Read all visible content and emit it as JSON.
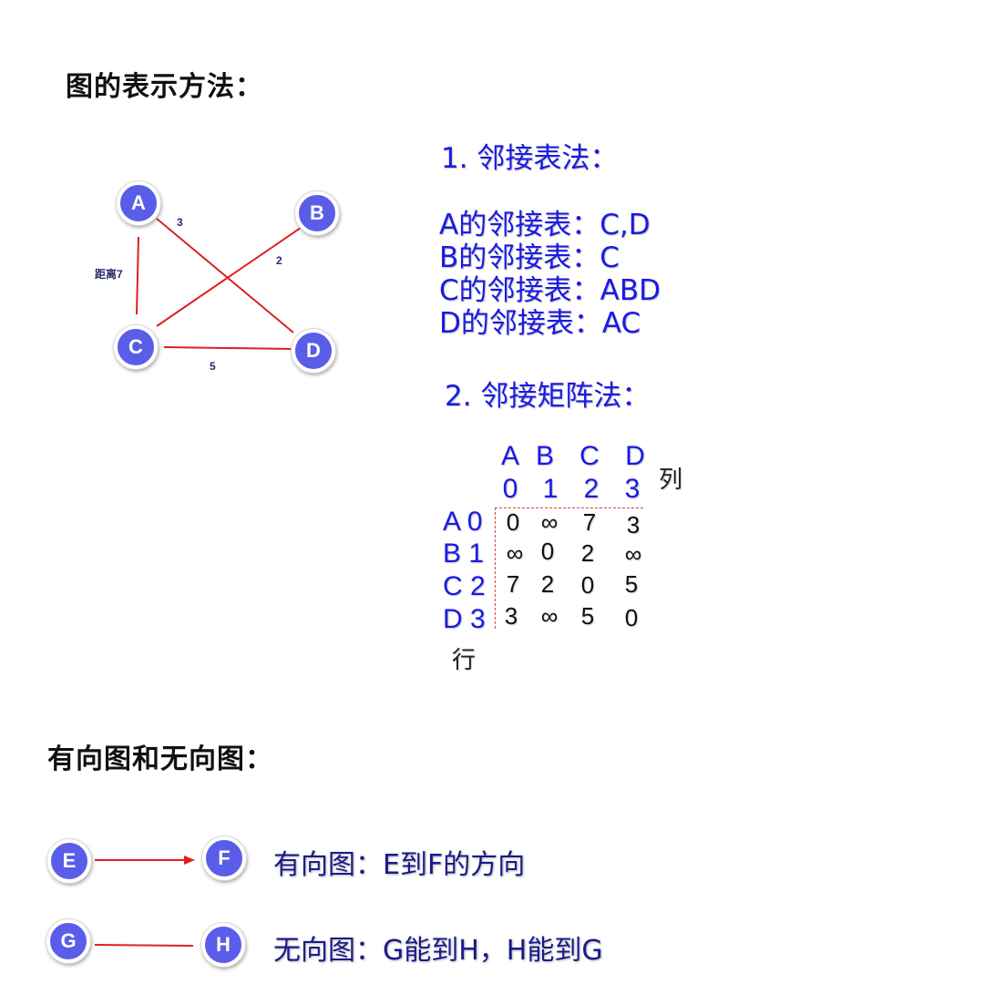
{
  "section1_title": "图的表示方法：",
  "section2_title": "有向图和无向图：",
  "graph": {
    "nodes": [
      "A",
      "B",
      "C",
      "D"
    ],
    "edge_labels": {
      "AD": "3",
      "BC": "2",
      "AC": "距离7",
      "CD": "5"
    },
    "edge_color": "#e02020",
    "node_color": "#5a5de8"
  },
  "adjacency_list": {
    "title": "1. 邻接表法：",
    "lines": [
      "A的邻接表：C,D",
      "B的邻接表：C",
      "C的邻接表：ABD",
      "D的邻接表：AC"
    ]
  },
  "adjacency_matrix": {
    "title": "2. 邻接矩阵法：",
    "col_letters": [
      "A",
      "B",
      "C",
      "D"
    ],
    "col_indices": [
      "0",
      "1",
      "2",
      "3"
    ],
    "col_note": "列",
    "row_labels": [
      "A 0",
      "B 1",
      "C 2",
      "D 3"
    ],
    "row_note": "行",
    "rows": [
      [
        "0",
        "∞",
        "7",
        "3"
      ],
      [
        "∞",
        "0",
        "2",
        "∞"
      ],
      [
        "7",
        "2",
        "0",
        "5"
      ],
      [
        "3",
        "∞",
        "5",
        "0"
      ]
    ]
  },
  "directed": {
    "from": "E",
    "to": "F",
    "description": "有向图：E到F的方向"
  },
  "undirected": {
    "from": "G",
    "to": "H",
    "description": "无向图：G能到H，H能到G"
  },
  "text_color": "#1a1ae6"
}
